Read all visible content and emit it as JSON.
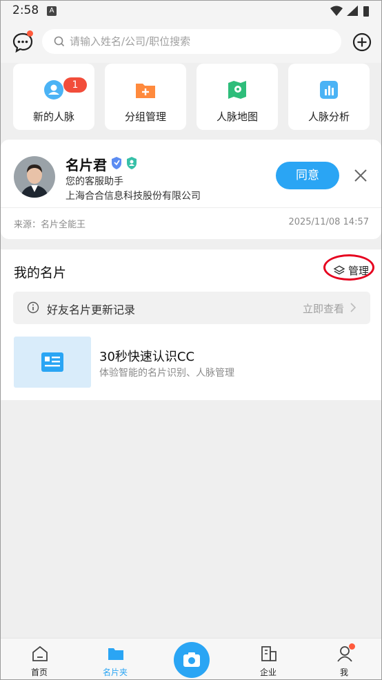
{
  "status_bar": {
    "time": "2:58",
    "notif_icon": "A"
  },
  "top_bar": {
    "search_placeholder": "请输入姓名/公司/职位搜索"
  },
  "tiles": [
    {
      "label": "新的人脉",
      "icon": "contact-icon",
      "badge": "1"
    },
    {
      "label": "分组管理",
      "icon": "folder-add-icon"
    },
    {
      "label": "人脉地图",
      "icon": "map-icon"
    },
    {
      "label": "人脉分析",
      "icon": "chart-icon"
    }
  ],
  "request_card": {
    "name": "名片君",
    "title": "您的客服助手",
    "company": "上海合合信息科技股份有限公司",
    "agree_label": "同意",
    "source": "来源：名片全能王",
    "date": "2025/11/08 14:57"
  },
  "my_cards": {
    "title": "我的名片",
    "manage_label": "管理",
    "update_label": "好友名片更新记录",
    "update_action": "立即查看",
    "intro_title": "30秒快速认识CC",
    "intro_subtitle": "体验智能的名片识别、人脉管理"
  },
  "tab_bar": {
    "tabs": [
      {
        "label": "首页"
      },
      {
        "label": "名片夹"
      },
      {
        "label": "企业"
      },
      {
        "label": "我"
      }
    ],
    "active": "名片夹"
  },
  "colors": {
    "accent": "#2aa5f4",
    "badge": "#f24d3a",
    "highlight_ring": "#e6001e"
  }
}
